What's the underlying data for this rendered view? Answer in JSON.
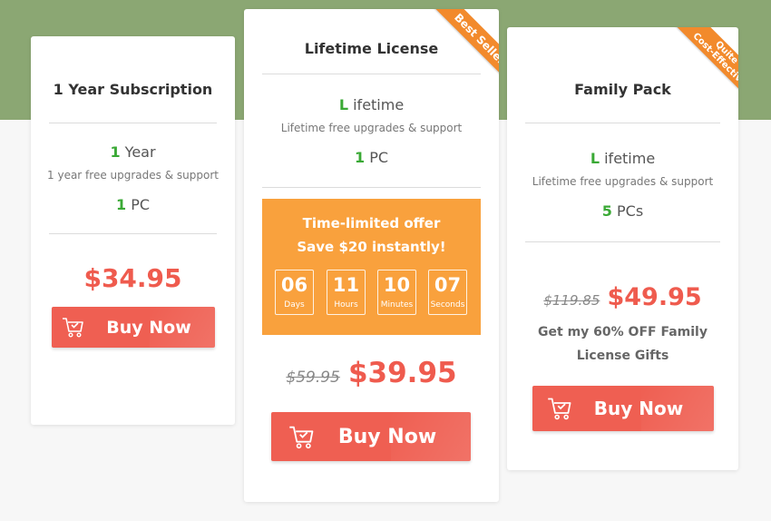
{
  "colors": {
    "band": "#8ba773",
    "accent_green": "#3aa935",
    "price_red": "#ef5b4e",
    "button": "#ef5f52",
    "offer_orange": "#f9a13d",
    "ribbon_orange": "#f28a2c"
  },
  "plans": [
    {
      "title": "1 Year Subscription",
      "term_num": "1",
      "term_text": "Year",
      "upgrade_note": "1 year free upgrades & support",
      "pc_num": "1",
      "pc_text": "PC",
      "price": "$34.95",
      "buy_label": "Buy Now"
    },
    {
      "title": "Lifetime License",
      "badge": "Best Seller",
      "term_num": "L",
      "term_text": "ifetime",
      "upgrade_note": "Lifetime free upgrades & support",
      "pc_num": "1",
      "pc_text": "PC",
      "offer": {
        "line1": "Time-limited offer",
        "line2": "Save $20 instantly!",
        "countdown": [
          {
            "value": "06",
            "label": "Days"
          },
          {
            "value": "11",
            "label": "Hours"
          },
          {
            "value": "10",
            "label": "Minutes"
          },
          {
            "value": "07",
            "label": "Seconds"
          }
        ]
      },
      "old_price": "$59.95",
      "price": "$39.95",
      "buy_label": "Buy Now"
    },
    {
      "title": "Family Pack",
      "badge_line1": "Quite",
      "badge_line2": "Cost-Effective",
      "term_num": "L",
      "term_text": "ifetime",
      "upgrade_note": "Lifetime free upgrades & support",
      "pc_num": "5",
      "pc_text": "PCs",
      "old_price": "$119.85",
      "price": "$49.95",
      "note_line1": "Get my 60% OFF Family",
      "note_line2": "License Gifts",
      "buy_label": "Buy Now"
    }
  ],
  "icons": {
    "cart": "shopping-cart-check-icon"
  }
}
